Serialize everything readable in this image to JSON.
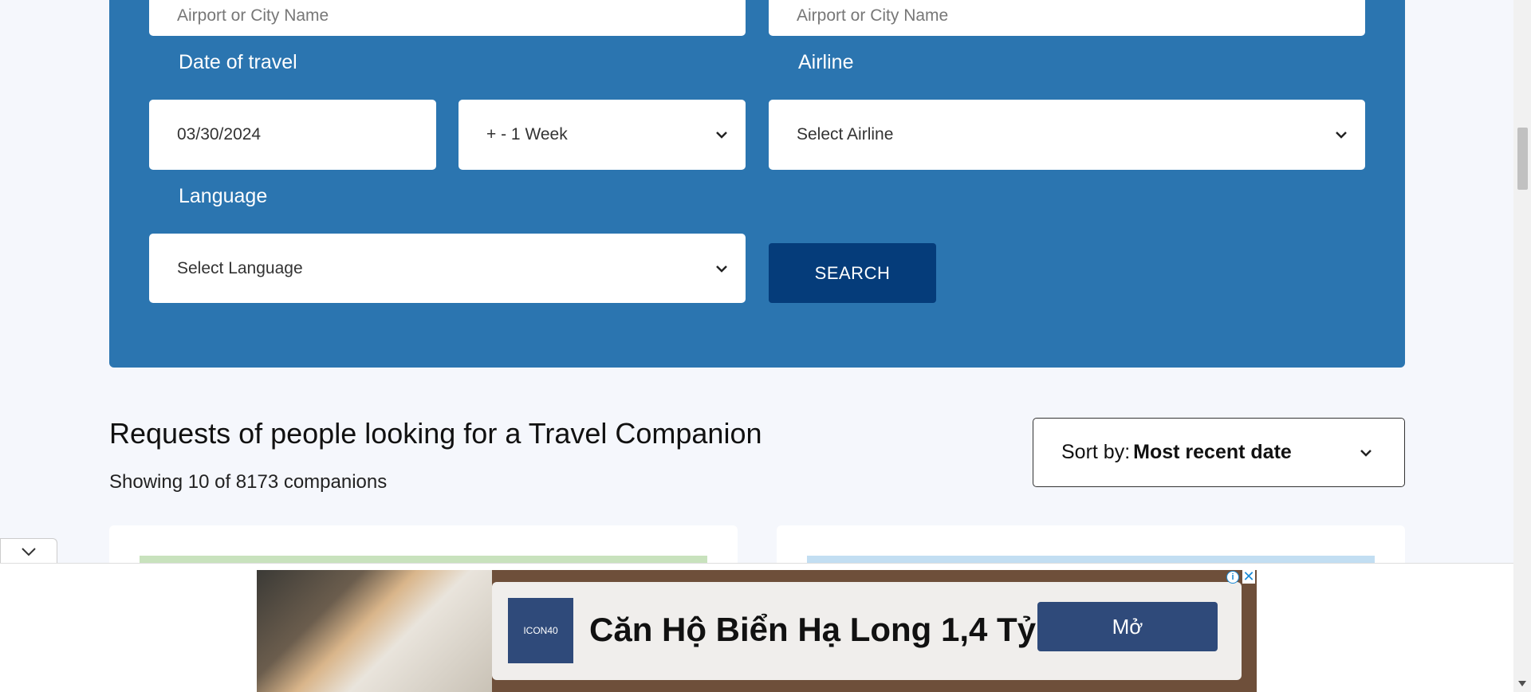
{
  "search": {
    "from_placeholder": "Airport or City Name",
    "to_placeholder": "Airport or City Name",
    "date_label": "Date of travel",
    "date_value": "03/30/2024",
    "range_value": "+ - 1 Week",
    "airline_label": "Airline",
    "airline_value": "Select Airline",
    "language_label": "Language",
    "language_value": "Select Language",
    "search_button": "SEARCH",
    "panel_color": "#2b75b0",
    "button_color": "#053c7a"
  },
  "results": {
    "heading": "Requests of people looking for a Travel Companion",
    "count_text": "Showing 10 of 8173 companions",
    "sort_label": "Sort by:",
    "sort_value": "Most recent date"
  },
  "cards": [
    {
      "stripe_color": "#c8e2bd"
    },
    {
      "stripe_color": "#c2def2"
    }
  ],
  "ad": {
    "logo_text": "ICON40",
    "headline": "Căn Hộ Biển Hạ Long 1,4 Tỷ",
    "button": "Mở",
    "info_icon": "info-icon",
    "close_icon": "close-icon"
  }
}
